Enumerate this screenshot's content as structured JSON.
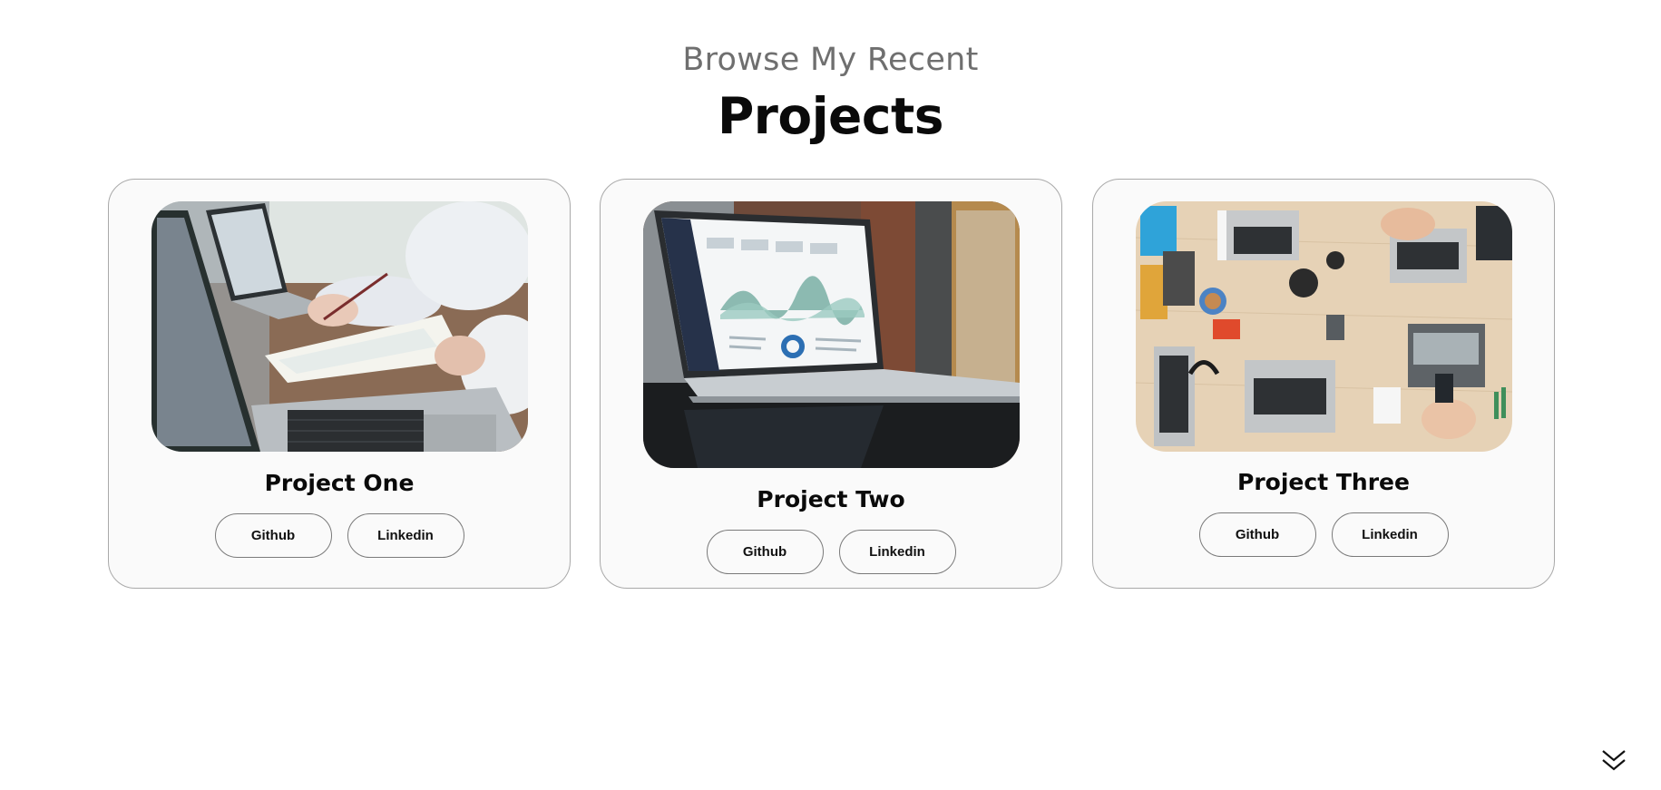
{
  "header": {
    "subtitle": "Browse My Recent",
    "title": "Projects"
  },
  "projects": [
    {
      "title": "Project One",
      "image_icon": "laptop-meeting-photo",
      "buttons": [
        {
          "label": "Github"
        },
        {
          "label": "Linkedin"
        }
      ]
    },
    {
      "title": "Project Two",
      "image_icon": "laptop-dashboard-photo",
      "buttons": [
        {
          "label": "Github"
        },
        {
          "label": "Linkedin"
        }
      ]
    },
    {
      "title": "Project Three",
      "image_icon": "team-desk-laptops-photo",
      "buttons": [
        {
          "label": "Github"
        },
        {
          "label": "Linkedin"
        }
      ]
    }
  ],
  "nav": {
    "scroll_icon": "double-chevron-down-icon"
  },
  "colors": {
    "subtitle": "#6f6f6f",
    "title": "#0a0a0a",
    "card_bg": "#fafafa",
    "card_border": "#a9a9a9"
  }
}
